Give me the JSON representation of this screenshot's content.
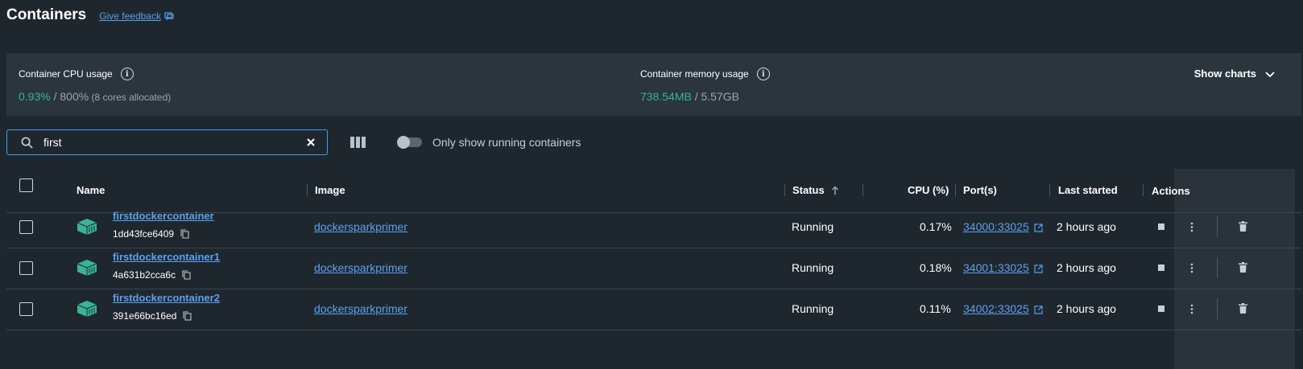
{
  "header": {
    "title": "Containers",
    "feedback_label": "Give feedback"
  },
  "usage": {
    "cpu_label": "Container CPU usage",
    "cpu_used": "0.93%",
    "cpu_total": " / 800%",
    "cpu_note": " (8 cores allocated)",
    "mem_label": "Container memory usage",
    "mem_used": "738.54MB",
    "mem_total": " / 5.57GB",
    "show_charts_label": "Show charts"
  },
  "toolbar": {
    "search_value": "first",
    "toggle_label": "Only show running containers"
  },
  "table": {
    "columns": {
      "name": "Name",
      "image": "Image",
      "status": "Status",
      "cpu": "CPU (%)",
      "ports": "Port(s)",
      "last_started": "Last started",
      "actions": "Actions"
    },
    "rows": [
      {
        "name": "firstdockercontainer",
        "id": "1dd43fce6409",
        "image": "dockersparkprimer",
        "status": "Running",
        "cpu": "0.17%",
        "ports": "34000:33025",
        "last_started": "2 hours ago"
      },
      {
        "name": "firstdockercontainer1",
        "id": "4a631b2cca6c",
        "image": "dockersparkprimer",
        "status": "Running",
        "cpu": "0.18%",
        "ports": "34001:33025",
        "last_started": "2 hours ago"
      },
      {
        "name": "firstdockercontainer2",
        "id": "391e66bc16ed",
        "image": "dockersparkprimer",
        "status": "Running",
        "cpu": "0.11%",
        "ports": "34002:33025",
        "last_started": "2 hours ago"
      }
    ]
  },
  "colors": {
    "accent": "#3f9bf0",
    "link": "#5aa0ee",
    "green": "#3bb394",
    "background": "#1f272e",
    "panel": "#2a353d"
  }
}
